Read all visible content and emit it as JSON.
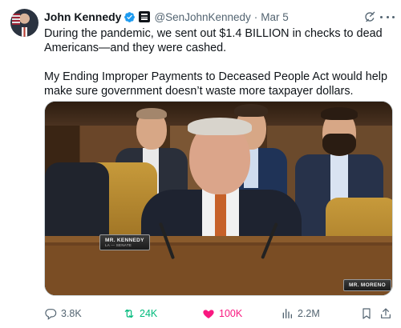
{
  "author": {
    "name": "John Kennedy",
    "handle": "@SenJohnKennedy",
    "separator": "·",
    "date": "Mar 5"
  },
  "tweet": {
    "paragraph_1": "During the pandemic, we sent out $1.4 BILLION in checks to dead Americans—and they were cashed.",
    "paragraph_2": "My Ending Improper Payments to Deceased People Act would help make sure government doesn’t waste more taxpayer dollars."
  },
  "media": {
    "nameplate_left": "MR. KENNEDY",
    "nameplate_left_sub": "LA — SENATE",
    "nameplate_right": "MR. MORENO"
  },
  "actions": {
    "replies": "3.8K",
    "reposts": "24K",
    "likes": "100K",
    "views": "2.2M"
  },
  "colors": {
    "text": "#0f1419",
    "secondary": "#536471",
    "verified": "#1d9bf0",
    "repost_active": "#00ba7c",
    "like_active": "#f91880"
  },
  "icons": [
    "verified-badge-icon",
    "government-badge-icon",
    "grok-icon",
    "more-icon",
    "reply-icon",
    "repost-icon",
    "like-icon",
    "views-icon",
    "bookmark-icon",
    "share-icon"
  ]
}
